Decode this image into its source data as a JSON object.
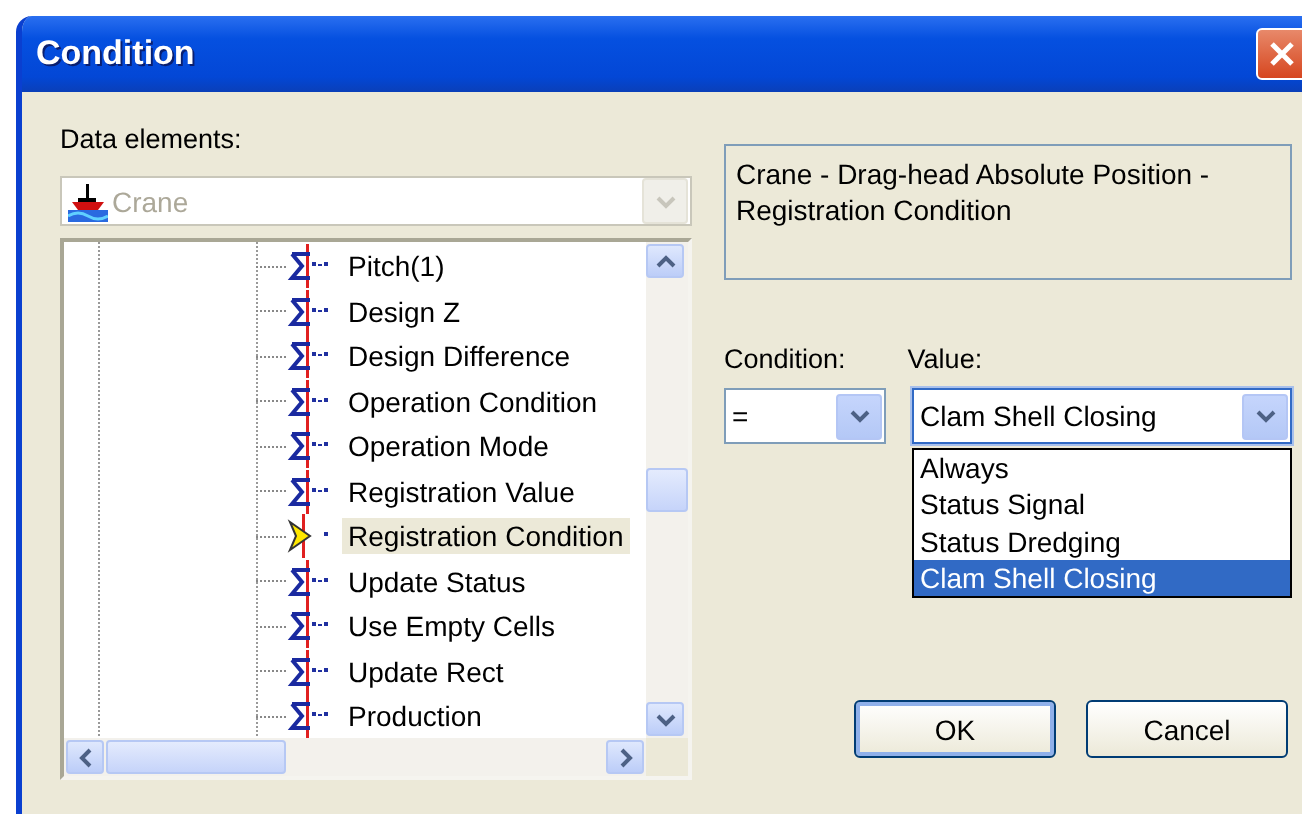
{
  "window": {
    "title": "Condition"
  },
  "data_elements": {
    "label": "Data elements:",
    "source": {
      "value": "Crane",
      "disabled": true
    },
    "items": [
      {
        "label": "Pitch(1)",
        "selected": false
      },
      {
        "label": "Design Z",
        "selected": false
      },
      {
        "label": "Design Difference",
        "selected": false
      },
      {
        "label": "Operation Condition",
        "selected": false
      },
      {
        "label": "Operation Mode",
        "selected": false
      },
      {
        "label": "Registration Value",
        "selected": false
      },
      {
        "label": "Registration Condition",
        "selected": true
      },
      {
        "label": "Update Status",
        "selected": false
      },
      {
        "label": "Use Empty Cells",
        "selected": false
      },
      {
        "label": "Update Rect",
        "selected": false
      },
      {
        "label": "Production",
        "selected": false
      }
    ]
  },
  "description": "Crane - Drag-head Absolute Position - Registration Condition",
  "condition": {
    "label": "Condition:",
    "value": "="
  },
  "value": {
    "label": "Value:",
    "value": "Clam Shell Closing",
    "expanded": true,
    "options": [
      {
        "label": "Always",
        "selected": false
      },
      {
        "label": "Status Signal",
        "selected": false
      },
      {
        "label": "Status Dredging",
        "selected": false
      },
      {
        "label": "Clam Shell Closing",
        "selected": true
      }
    ]
  },
  "buttons": [
    {
      "label": "OK",
      "default": true
    },
    {
      "label": "Cancel",
      "default": false
    }
  ]
}
